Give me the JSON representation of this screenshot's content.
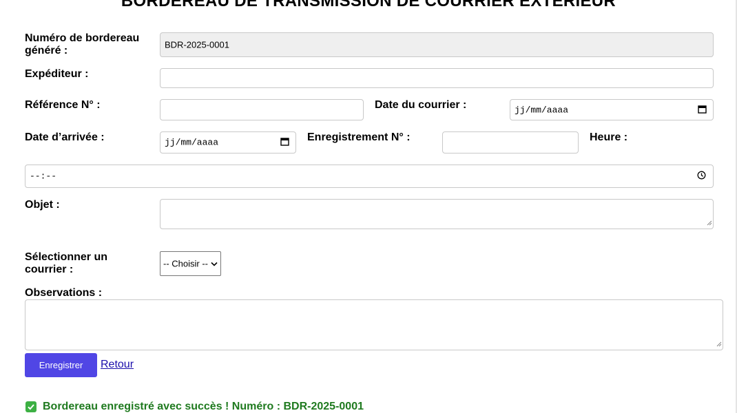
{
  "page_title": "BORDEREAU DE TRANSMISSION DE COURRIER EXTÉRIEUR",
  "form": {
    "numero_label_line1": "Numéro de bordereau",
    "numero_label_line2": "généré :",
    "numero_value": "BDR-2025-0001",
    "expediteur_label": "Expéditeur :",
    "expediteur_value": "",
    "reference_label": "Référence N° :",
    "reference_value": "",
    "date_courrier_label": "Date du courrier :",
    "date_courrier_placeholder": "jj/mm/aaaa",
    "date_arrivee_label": "Date d’arrivée :",
    "date_arrivee_placeholder": "jj/mm/aaaa",
    "enregistrement_label": "Enregistrement N° :",
    "enregistrement_value": "",
    "heure_label": "Heure :",
    "heure_placeholder": "--:--",
    "objet_label": "Objet :",
    "objet_value": "",
    "courrier_label_line1": "Sélectionner un",
    "courrier_label_line2": "courrier :",
    "courrier_selected": "-- Choisir --",
    "observations_label": "Observations :",
    "observations_value": ""
  },
  "actions": {
    "save_label": "Enregistrer",
    "back_label": "Retour"
  },
  "status": {
    "message": "Bordereau enregistré avec succès ! Numéro : BDR-2025-0001",
    "color": "#1f7a1f"
  },
  "icons": {
    "calendar": "calendar-icon",
    "clock": "clock-icon",
    "success": "check-box-icon"
  },
  "colors": {
    "button_bg": "#5046e5",
    "readonly_bg": "#efefef",
    "link": "#1a0dab"
  }
}
